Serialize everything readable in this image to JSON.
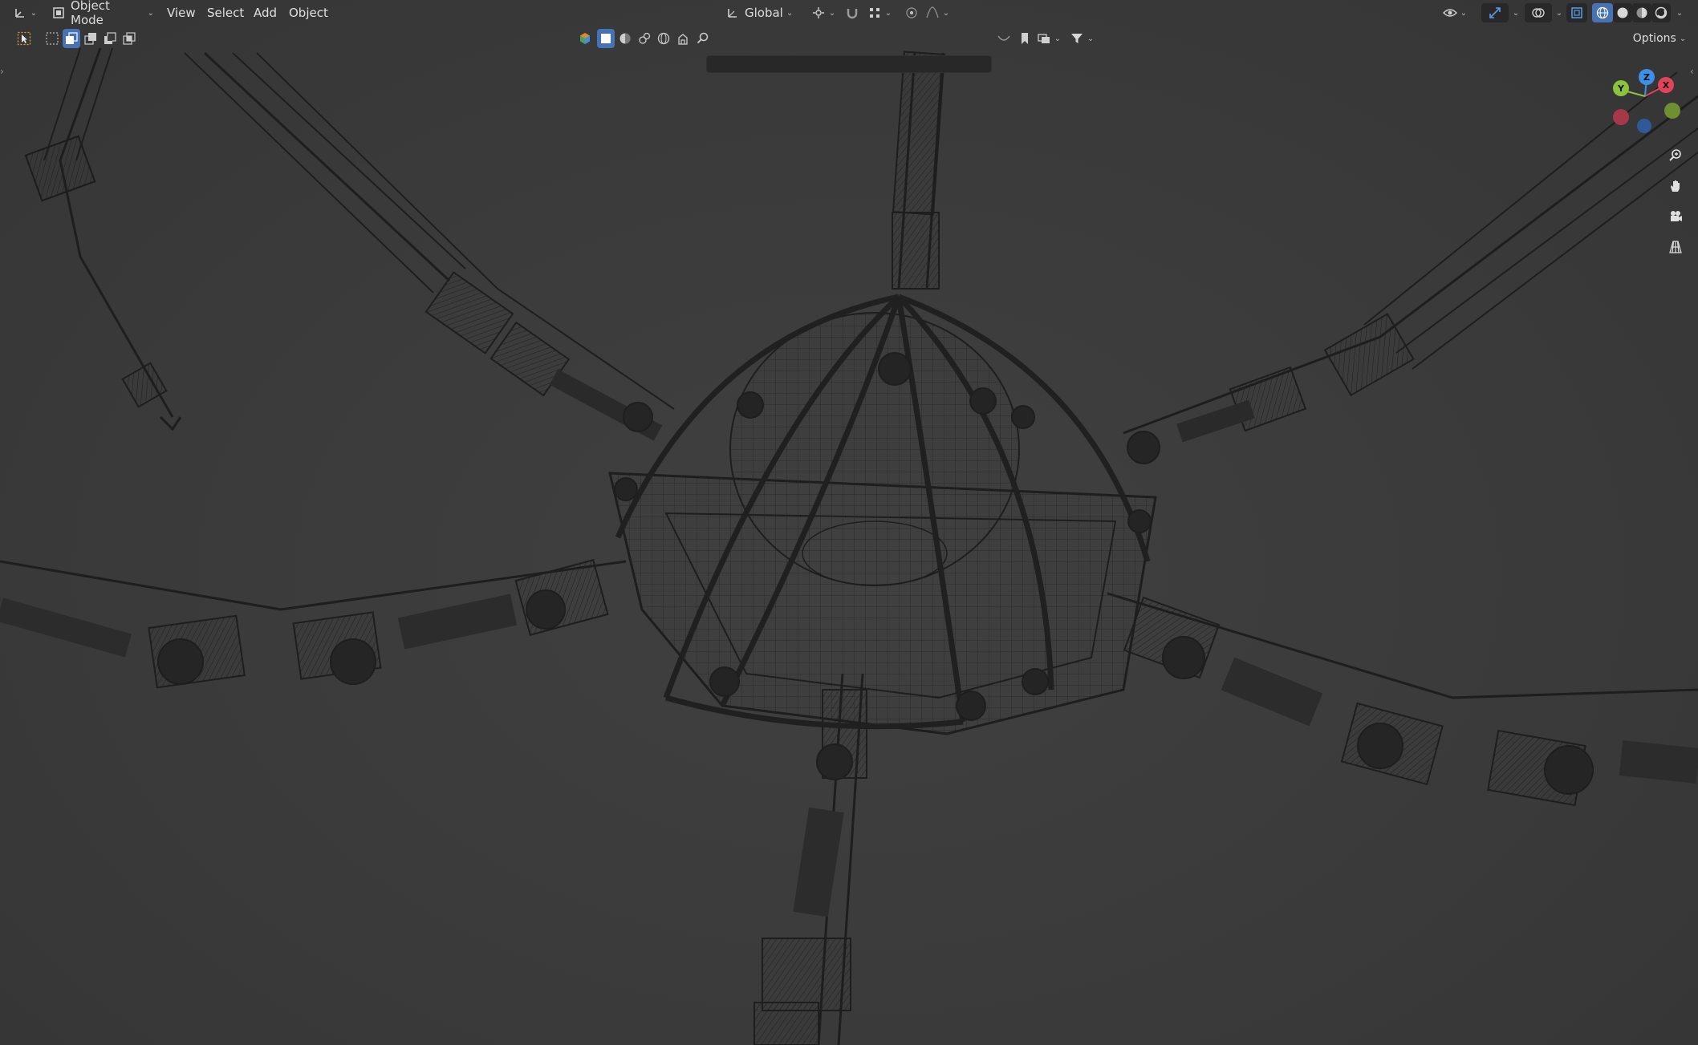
{
  "header": {
    "mode": {
      "label": "Object Mode"
    },
    "menus": [
      "View",
      "Select",
      "Add",
      "Object"
    ],
    "transform_orientation": {
      "label": "Global"
    }
  },
  "toolbar": {
    "options_label": "Options"
  },
  "gizmo": {
    "z_label": "Z",
    "x_label": "X",
    "y_label": "Y",
    "colors": {
      "x": "#e0435a",
      "y": "#8bc43c",
      "z": "#3d8fe8"
    }
  },
  "right_tools": [
    "zoom-icon",
    "hand-pan-icon",
    "camera-icon",
    "grid-perspective-icon"
  ],
  "viewport": {
    "shading": "wireframe",
    "background": "#3d3d3d"
  }
}
